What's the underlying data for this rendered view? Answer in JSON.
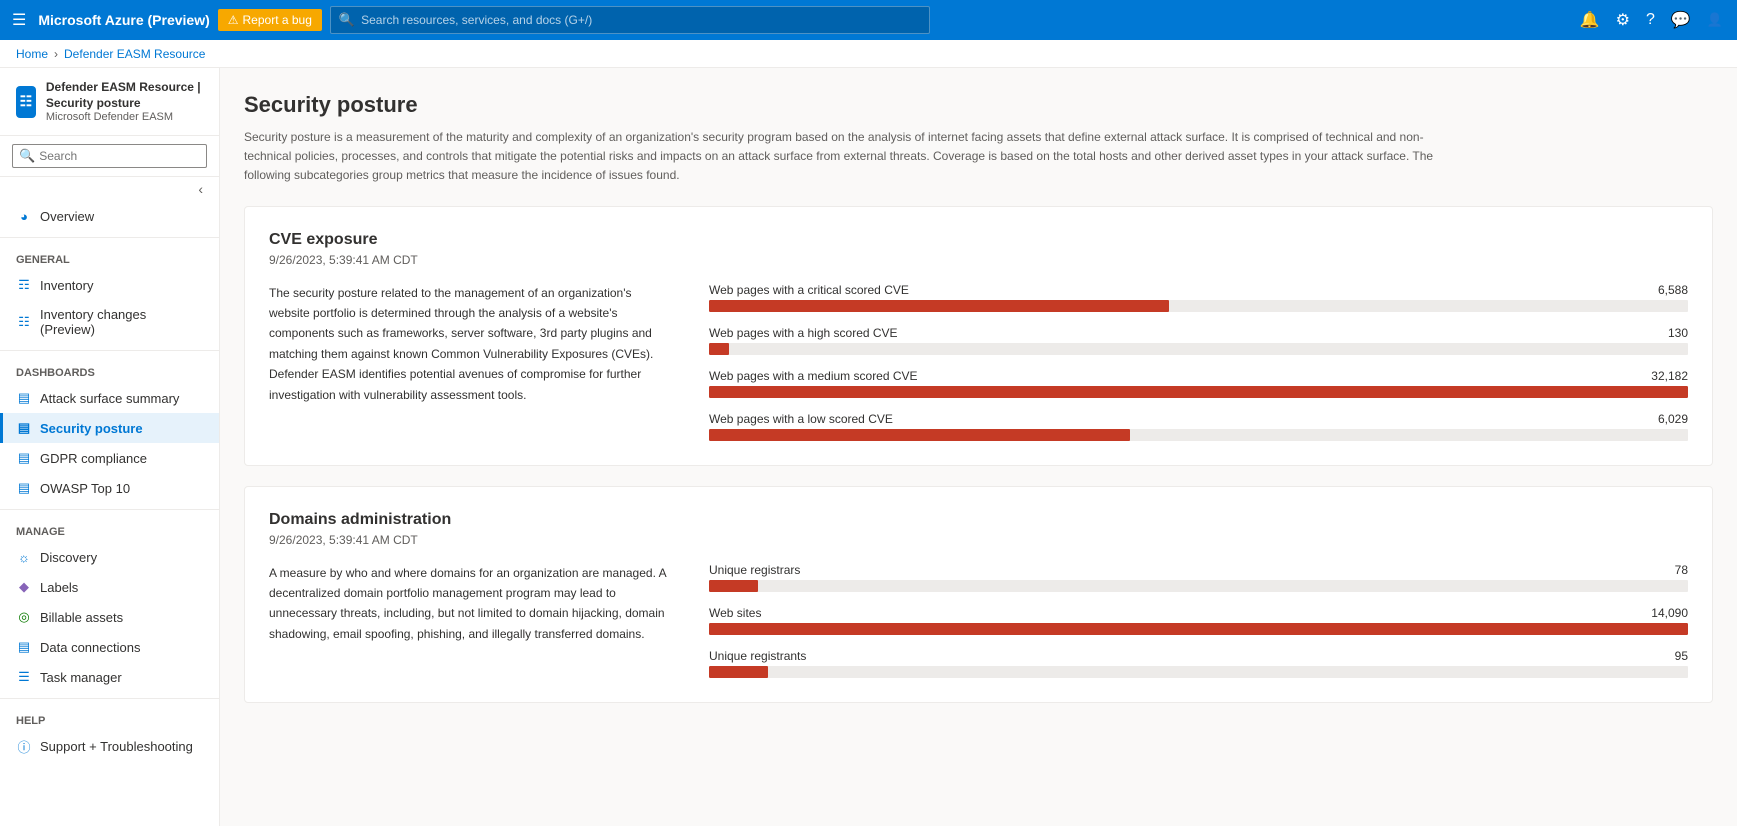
{
  "topnav": {
    "app_title": "Microsoft Azure (Preview)",
    "report_bug": "Report a bug",
    "search_placeholder": "Search resources, services, and docs (G+/)"
  },
  "breadcrumb": {
    "home": "Home",
    "resource": "Defender EASM Resource"
  },
  "sidebar_header": {
    "title": "Defender EASM Resource | Security posture",
    "subtitle": "Microsoft Defender EASM"
  },
  "sidebar_search": {
    "placeholder": "Search"
  },
  "sidebar": {
    "overview_label": "Overview",
    "general_label": "General",
    "dashboards_label": "Dashboards",
    "manage_label": "Manage",
    "help_label": "Help",
    "items": {
      "overview": "Overview",
      "inventory": "Inventory",
      "inventory_changes": "Inventory changes (Preview)",
      "attack_surface": "Attack surface summary",
      "security_posture": "Security posture",
      "gdpr": "GDPR compliance",
      "owasp": "OWASP Top 10",
      "discovery": "Discovery",
      "labels": "Labels",
      "billable": "Billable assets",
      "data_connections": "Data connections",
      "task_manager": "Task manager",
      "support": "Support + Troubleshooting"
    }
  },
  "main": {
    "page_title": "Security posture",
    "page_description": "Security posture is a measurement of the maturity and complexity of an organization's security program based on the analysis of internet facing assets that define external attack surface. It is comprised of technical and non-technical policies, processes, and controls that mitigate the potential risks and impacts on an attack surface from external threats. Coverage is based on the total hosts and other derived asset types in your attack surface. The following subcategories group metrics that measure the incidence of issues found.",
    "cve": {
      "title": "CVE exposure",
      "date": "9/26/2023, 5:39:41 AM CDT",
      "description": "The security posture related to the management of an organization's website portfolio is determined through the analysis of a website's components such as frameworks, server software, 3rd party plugins and matching them against known Common Vulnerability Exposures (CVEs). Defender EASM identifies potential avenues of compromise for further investigation with vulnerability assessment tools.",
      "bars": [
        {
          "label": "Web pages with a critical scored CVE",
          "value": "6,588",
          "pct": 47
        },
        {
          "label": "Web pages with a high scored CVE",
          "value": "130",
          "pct": 2
        },
        {
          "label": "Web pages with a medium scored CVE",
          "value": "32,182",
          "pct": 100
        },
        {
          "label": "Web pages with a low scored CVE",
          "value": "6,029",
          "pct": 43
        }
      ]
    },
    "domains": {
      "title": "Domains administration",
      "date": "9/26/2023, 5:39:41 AM CDT",
      "description": "A measure by who and where domains for an organization are managed. A decentralized domain portfolio management program may lead to unnecessary threats, including, but not limited to domain hijacking, domain shadowing, email spoofing, phishing, and illegally transferred domains.",
      "bars": [
        {
          "label": "Unique registrars",
          "value": "78",
          "pct": 5
        },
        {
          "label": "Web sites",
          "value": "14,090",
          "pct": 100
        },
        {
          "label": "Unique registrants",
          "value": "95",
          "pct": 6
        }
      ]
    }
  }
}
